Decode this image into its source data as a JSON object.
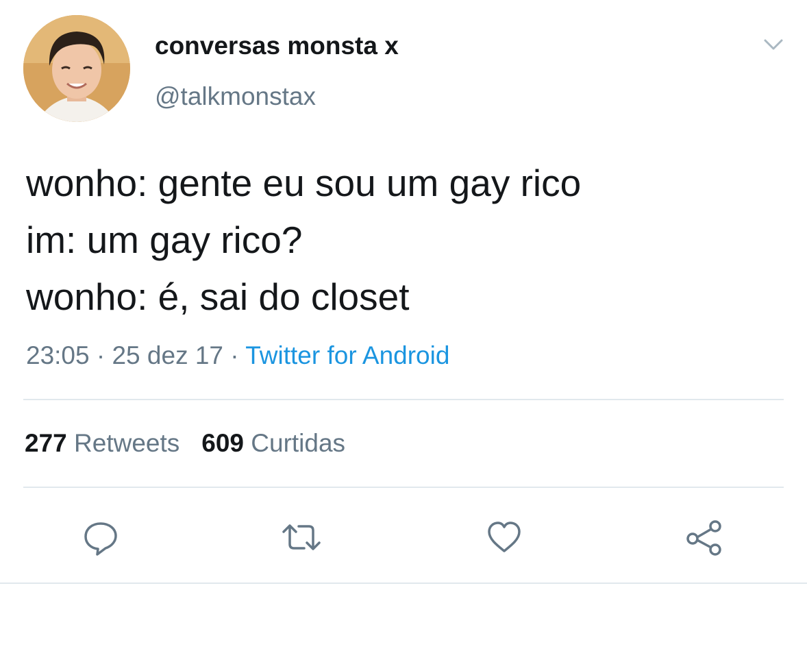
{
  "author": {
    "display_name": "conversas monsta x",
    "handle": "@talkmonstax",
    "avatar_icon": "profile-photo"
  },
  "tweet": {
    "lines": [
      "wonho: gente eu sou um gay rico",
      "im: um gay rico?",
      "wonho: é, sai do closet"
    ],
    "time": "23:05",
    "separator": " · ",
    "date": "25 dez 17",
    "source": "Twitter for Android"
  },
  "stats": {
    "retweets_count": "277",
    "retweets_label": "Retweets",
    "likes_count": "609",
    "likes_label": "Curtidas"
  },
  "actions": {
    "icons": [
      "reply-icon",
      "retweet-icon",
      "like-icon",
      "share-icon"
    ]
  },
  "colors": {
    "text": "#14171a",
    "secondary": "#657786",
    "link": "#1b95e0",
    "divider": "#e1e8ed"
  }
}
